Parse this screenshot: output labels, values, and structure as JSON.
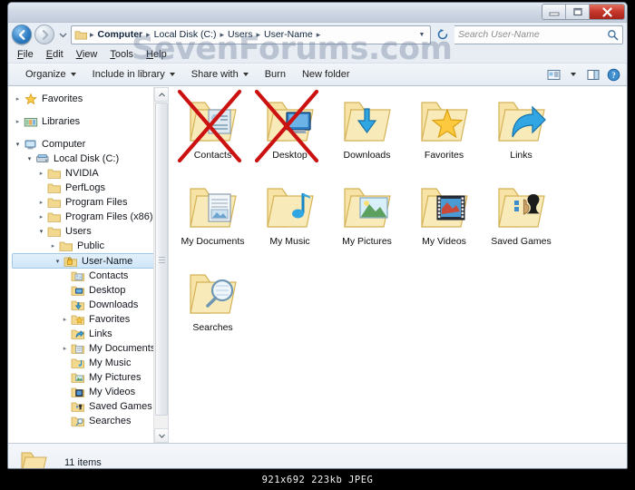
{
  "window": {
    "controls": {
      "minimize_label": "Minimize",
      "maximize_label": "Maximize",
      "close_label": "Close"
    }
  },
  "address_bar": {
    "back_label": "Back",
    "forward_label": "Forward",
    "history_label": "Recent pages",
    "folder_icon": "folder-icon",
    "crumbs": [
      "Computer",
      "Local Disk (C:)",
      "Users",
      "User-Name"
    ],
    "separator": "▸",
    "dropdown_label": "Previous locations",
    "refresh_label": "Refresh",
    "search": {
      "placeholder": "Search User-Name",
      "value": "",
      "icon": "search-icon"
    }
  },
  "menubar": {
    "items": [
      {
        "label": "File",
        "mnemonic": "F"
      },
      {
        "label": "Edit",
        "mnemonic": "E"
      },
      {
        "label": "View",
        "mnemonic": "V"
      },
      {
        "label": "Tools",
        "mnemonic": "T"
      },
      {
        "label": "Help",
        "mnemonic": "H"
      }
    ]
  },
  "toolbar": {
    "organize": "Organize",
    "include_in_library": "Include in library",
    "share_with": "Share with",
    "burn": "Burn",
    "new_folder": "New folder",
    "change_view_label": "Change your view",
    "view_dropdown_label": "More options",
    "preview_pane_label": "Show the preview pane",
    "help_label": "Get help"
  },
  "sidebar": {
    "items": [
      {
        "label": "Favorites",
        "indent": 0,
        "arrow": "collapsed",
        "icon": "star-icon",
        "gap": false,
        "selected": false
      },
      {
        "label": "Libraries",
        "indent": 0,
        "arrow": "collapsed",
        "icon": "libraries-icon",
        "gap": true,
        "selected": false
      },
      {
        "label": "Computer",
        "indent": 0,
        "arrow": "expanded",
        "icon": "computer-icon",
        "gap": true,
        "selected": false
      },
      {
        "label": "Local Disk (C:)",
        "indent": 1,
        "arrow": "expanded",
        "icon": "harddisk-icon",
        "gap": false,
        "selected": false
      },
      {
        "label": "NVIDIA",
        "indent": 2,
        "arrow": "collapsed",
        "icon": "folder-icon",
        "gap": false,
        "selected": false
      },
      {
        "label": "PerfLogs",
        "indent": 2,
        "arrow": "none",
        "icon": "folder-icon",
        "gap": false,
        "selected": false
      },
      {
        "label": "Program Files",
        "indent": 2,
        "arrow": "collapsed",
        "icon": "folder-icon",
        "gap": false,
        "selected": false
      },
      {
        "label": "Program Files (x86)",
        "indent": 2,
        "arrow": "collapsed",
        "icon": "folder-icon",
        "gap": false,
        "selected": false
      },
      {
        "label": "Users",
        "indent": 2,
        "arrow": "expanded",
        "icon": "folder-icon",
        "gap": false,
        "selected": false
      },
      {
        "label": "Public",
        "indent": 3,
        "arrow": "collapsed",
        "icon": "folder-icon",
        "gap": false,
        "selected": false
      },
      {
        "label": "User-Name",
        "indent": 3,
        "arrow": "expanded",
        "icon": "userfolder-icon",
        "gap": false,
        "selected": true
      },
      {
        "label": "Contacts",
        "indent": 4,
        "arrow": "none",
        "icon": "contacts-icon",
        "gap": false,
        "selected": false
      },
      {
        "label": "Desktop",
        "indent": 4,
        "arrow": "none",
        "icon": "desktop-icon",
        "gap": false,
        "selected": false
      },
      {
        "label": "Downloads",
        "indent": 4,
        "arrow": "none",
        "icon": "downloads-icon",
        "gap": false,
        "selected": false
      },
      {
        "label": "Favorites",
        "indent": 4,
        "arrow": "collapsed",
        "icon": "favorites-icon",
        "gap": false,
        "selected": false
      },
      {
        "label": "Links",
        "indent": 4,
        "arrow": "none",
        "icon": "links-icon",
        "gap": false,
        "selected": false
      },
      {
        "label": "My Documents",
        "indent": 4,
        "arrow": "collapsed",
        "icon": "documents-icon",
        "gap": false,
        "selected": false
      },
      {
        "label": "My Music",
        "indent": 4,
        "arrow": "none",
        "icon": "music-icon",
        "gap": false,
        "selected": false
      },
      {
        "label": "My Pictures",
        "indent": 4,
        "arrow": "none",
        "icon": "pictures-icon",
        "gap": false,
        "selected": false
      },
      {
        "label": "My Videos",
        "indent": 4,
        "arrow": "none",
        "icon": "videos-icon",
        "gap": false,
        "selected": false
      },
      {
        "label": "Saved Games",
        "indent": 4,
        "arrow": "none",
        "icon": "savedgames-icon",
        "gap": false,
        "selected": false
      },
      {
        "label": "Searches",
        "indent": 4,
        "arrow": "none",
        "icon": "searches-icon",
        "gap": false,
        "selected": false
      }
    ],
    "scroll_up_label": "Scroll up",
    "scroll_down_label": "Scroll down"
  },
  "files": {
    "items": [
      {
        "name": "Contacts",
        "icon": "contacts-folder-icon",
        "crossed_out": true
      },
      {
        "name": "Desktop",
        "icon": "desktop-folder-icon",
        "crossed_out": true
      },
      {
        "name": "Downloads",
        "icon": "downloads-folder-icon",
        "crossed_out": false
      },
      {
        "name": "Favorites",
        "icon": "favorites-folder-icon",
        "crossed_out": false
      },
      {
        "name": "Links",
        "icon": "links-folder-icon",
        "crossed_out": false
      },
      {
        "name": "My Documents",
        "icon": "documents-folder-icon",
        "crossed_out": false
      },
      {
        "name": "My Music",
        "icon": "music-folder-icon",
        "crossed_out": false
      },
      {
        "name": "My Pictures",
        "icon": "pictures-folder-icon",
        "crossed_out": false
      },
      {
        "name": "My Videos",
        "icon": "videos-folder-icon",
        "crossed_out": false
      },
      {
        "name": "Saved Games",
        "icon": "savedgames-folder-icon",
        "crossed_out": false
      },
      {
        "name": "Searches",
        "icon": "searches-folder-icon",
        "crossed_out": false
      }
    ]
  },
  "status_bar": {
    "icon": "folder-icon",
    "text": "11 items"
  },
  "watermark": {
    "text": "SevenForums.com"
  },
  "footer": {
    "text": "921x692 223kb JPEG"
  },
  "colors": {
    "accent_blue": "#2f7fc4",
    "close_red": "#c5362a",
    "folder_yellow": "#f5d98a",
    "cross_red": "#cc1111",
    "selection_blue": "#cfe6f9",
    "watermark_gray": "#5c708c"
  }
}
